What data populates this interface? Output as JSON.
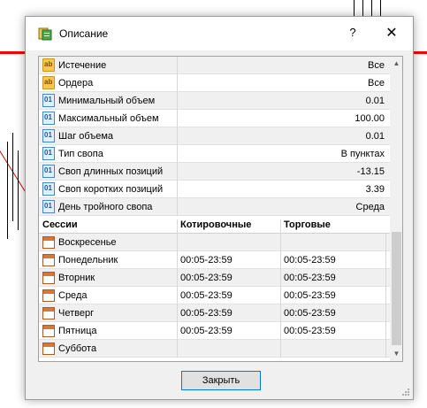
{
  "window": {
    "title": "Описание",
    "help_glyph": "?",
    "close_glyph": "✕"
  },
  "properties": [
    {
      "icon": "ab",
      "label": "Истечение",
      "value": "Все"
    },
    {
      "icon": "ab",
      "label": "Ордера",
      "value": "Все"
    },
    {
      "icon": "01",
      "label": "Минимальный объем",
      "value": "0.01"
    },
    {
      "icon": "01",
      "label": "Максимальный объем",
      "value": "100.00"
    },
    {
      "icon": "01",
      "label": "Шаг объема",
      "value": "0.01"
    },
    {
      "icon": "01",
      "label": "Тип свопа",
      "value": "В пунктах"
    },
    {
      "icon": "01",
      "label": "Своп длинных позиций",
      "value": "-13.15"
    },
    {
      "icon": "01",
      "label": "Своп коротких позиций",
      "value": "3.39"
    },
    {
      "icon": "01",
      "label": "День тройного свопа",
      "value": "Среда"
    }
  ],
  "sessions": {
    "headers": [
      "Сессии",
      "Котировочные",
      "Торговые"
    ],
    "rows": [
      {
        "day": "Воскресенье",
        "quote": "",
        "trade": ""
      },
      {
        "day": "Понедельник",
        "quote": "00:05-23:59",
        "trade": "00:05-23:59"
      },
      {
        "day": "Вторник",
        "quote": "00:05-23:59",
        "trade": "00:05-23:59"
      },
      {
        "day": "Среда",
        "quote": "00:05-23:59",
        "trade": "00:05-23:59"
      },
      {
        "day": "Четверг",
        "quote": "00:05-23:59",
        "trade": "00:05-23:59"
      },
      {
        "day": "Пятница",
        "quote": "00:05-23:59",
        "trade": "00:05-23:59"
      },
      {
        "day": "Суббота",
        "quote": "",
        "trade": ""
      }
    ]
  },
  "footer": {
    "close_label": "Закрыть"
  },
  "colors": {
    "accent": "#0078d7",
    "price_line": "#ff0000"
  }
}
